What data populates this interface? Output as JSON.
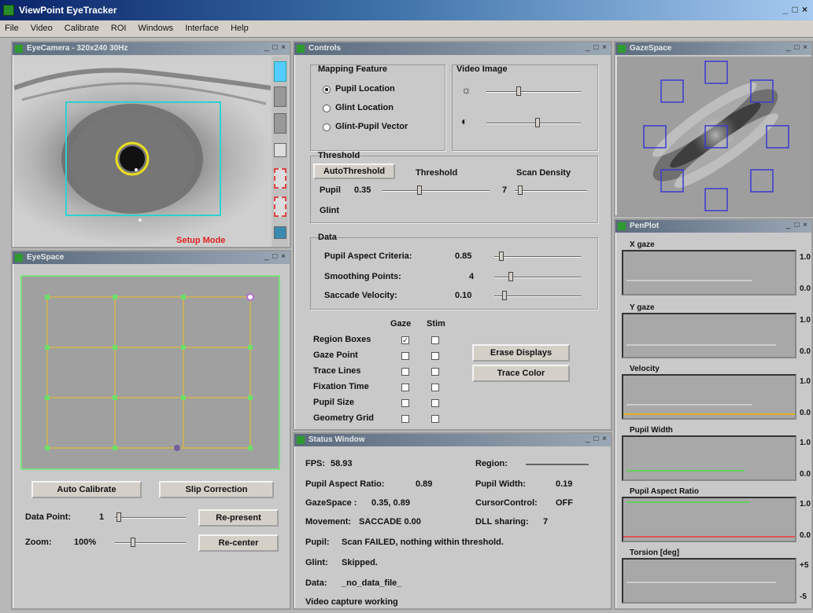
{
  "app": {
    "title": "ViewPoint EyeTracker",
    "window_buttons": "_ □ ×"
  },
  "menu": [
    "File",
    "Video",
    "Calibrate",
    "ROI",
    "Windows",
    "Interface",
    "Help"
  ],
  "windows": {
    "eye_camera": {
      "title": "EyeCamera - 320x240 30Hz",
      "mode_label": "Setup Mode"
    },
    "eye_space": {
      "title": "EyeSpace"
    },
    "controls": {
      "title": "Controls"
    },
    "gaze_space": {
      "title": "GazeSpace"
    },
    "pen_plot": {
      "title": "PenPlot"
    },
    "status_window": {
      "title": "Status Window"
    }
  },
  "eye_space": {
    "auto_calibrate": "Auto Calibrate",
    "slip_correction": "Slip Correction",
    "data_point_label": "Data Point:",
    "data_point_value": "1",
    "re_present": "Re-present",
    "zoom_label": "Zoom:",
    "zoom_value": "100%",
    "re_center": "Re-center"
  },
  "controls": {
    "mapping_feature": {
      "title": "Mapping Feature",
      "options": [
        "Pupil Location",
        "Glint Location",
        "Glint-Pupil Vector"
      ],
      "selected": "Pupil Location"
    },
    "video_image": {
      "title": "Video Image",
      "brightness_icon": "sun-icon",
      "contrast_icon": "contrast-icon"
    },
    "threshold": {
      "title": "Threshold",
      "autothreshold": "AutoThreshold",
      "threshold_label": "Threshold",
      "scan_density_label": "Scan Density",
      "pupil_label": "Pupil",
      "pupil_value": "0.35",
      "scan_value": "7",
      "glint_label": "Glint"
    },
    "data": {
      "title": "Data",
      "rows": [
        {
          "label": "Pupil Aspect Criteria:",
          "value": "0.85"
        },
        {
          "label": "Smoothing Points:",
          "value": "4"
        },
        {
          "label": "Saccade Velocity:",
          "value": "0.10"
        }
      ]
    },
    "display": {
      "col_gaze": "Gaze",
      "col_stim": "Stim",
      "rows": [
        {
          "label": "Region Boxes",
          "gaze": true,
          "stim": false
        },
        {
          "label": "Gaze Point",
          "gaze": false,
          "stim": false
        },
        {
          "label": "Trace Lines",
          "gaze": false,
          "stim": false
        },
        {
          "label": "Fixation Time",
          "gaze": false,
          "stim": false
        },
        {
          "label": "Pupil Size",
          "gaze": false,
          "stim": false
        },
        {
          "label": "Geometry Grid",
          "gaze": false,
          "stim": false
        }
      ],
      "erase_displays": "Erase Displays",
      "trace_color": "Trace Color"
    }
  },
  "pen_plot": {
    "plots": [
      {
        "label": "X gaze",
        "top": "1.0",
        "bottom": "0.0"
      },
      {
        "label": "Y gaze",
        "top": "1.0",
        "bottom": "0.0"
      },
      {
        "label": "Velocity",
        "top": "1.0",
        "bottom": "0.0"
      },
      {
        "label": "Pupil Width",
        "top": "1.0",
        "bottom": "0.0"
      },
      {
        "label": "Pupil Aspect Ratio",
        "top": "1.0",
        "bottom": "0.0"
      },
      {
        "label": "Torsion [deg]",
        "top": "+5",
        "bottom": "-5"
      }
    ]
  },
  "status": {
    "fps_label": "FPS:",
    "fps": "58.93",
    "region_label": "Region:",
    "pupil_aspect_label": "Pupil Aspect Ratio:",
    "pupil_aspect": "0.89",
    "pupil_width_label": "Pupil Width:",
    "pupil_width": "0.19",
    "gazespace_label": "GazeSpace :",
    "gazespace": "0.35, 0.89",
    "cursor_label": "CursorControl:",
    "cursor": "OFF",
    "movement_label": "Movement:",
    "movement": "SACCADE  0.00",
    "dll_label": "DLL sharing:",
    "dll": "7",
    "pupil_msg_label": "Pupil:",
    "pupil_msg": "Scan FAILED, nothing within threshold.",
    "glint_msg_label": "Glint:",
    "glint_msg": "Skipped.",
    "data_label": "Data:",
    "data_file": "_no_data_file_",
    "video_msg": "Video capture working"
  }
}
